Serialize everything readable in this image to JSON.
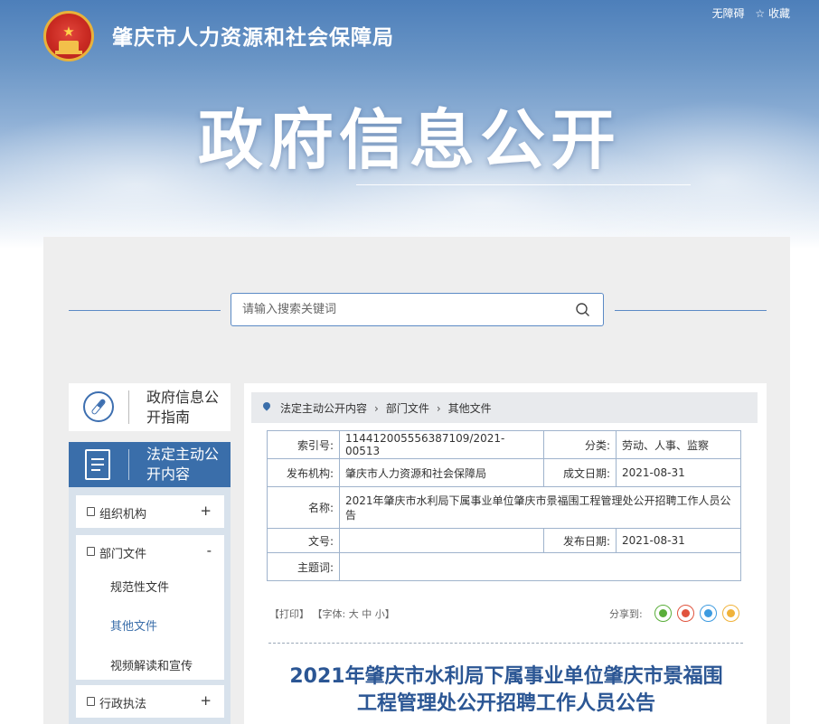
{
  "header": {
    "agency_name": "肇庆市人力资源和社会保障局",
    "accessibility_link": "无障碍",
    "favorite_link": "☆ 收藏",
    "site_title": "政府信息公开"
  },
  "search": {
    "placeholder": "请输入搜索关键词"
  },
  "sidebar": {
    "guide_label": "政府信息公开指南",
    "active_label": "法定主动公开内容",
    "items": [
      {
        "label": "组织机构",
        "sign": "+"
      },
      {
        "label": "部门文件",
        "sign": "-"
      },
      {
        "label": "行政执法",
        "sign": "+"
      }
    ],
    "sub_items": [
      "规范性文件",
      "其他文件",
      "视频解读和宣传"
    ]
  },
  "breadcrumb": [
    "法定主动公开内容",
    "部门文件",
    "其他文件"
  ],
  "meta": {
    "index_label": "索引号:",
    "index_value": "114412005556387109/2021-00513",
    "category_label": "分类:",
    "category_value": "劳动、人事、监察",
    "publisher_label": "发布机构:",
    "publisher_value": "肇庆市人力资源和社会保障局",
    "created_label": "成文日期:",
    "created_value": "2021-08-31",
    "name_label": "名称:",
    "name_value": "2021年肇庆市水利局下属事业单位肇庆市景福围工程管理处公开招聘工作人员公告",
    "docno_label": "文号:",
    "docno_value": "",
    "pubdate_label": "发布日期:",
    "pubdate_value": "2021-08-31",
    "subject_label": "主题词:",
    "subject_value": ""
  },
  "tools": {
    "print": "【打印】",
    "font_prefix": "【字体:",
    "font_large": "大",
    "font_medium": "中",
    "font_small": "小",
    "font_suffix": "】",
    "share_label": "分享到:"
  },
  "share_icons": [
    "wechat-icon",
    "weibo-icon",
    "qq-icon",
    "qzone-icon"
  ],
  "colors": {
    "accent": "#3a6eaa",
    "title": "#2b5694"
  },
  "article": {
    "title_line1": "2021年肇庆市水利局下属事业单位肇庆市景福围",
    "title_line2": "工程管理处公开招聘工作人员公告"
  }
}
